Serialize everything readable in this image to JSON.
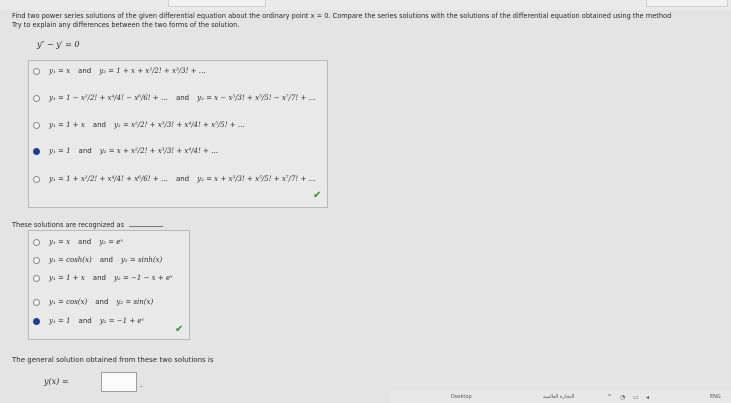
{
  "question": {
    "line1": "Find two power series solutions of the given differential equation about the ordinary point x = 0. Compare the series solutions with the solutions of the differential equation obtained using the method",
    "line2": "Try to explain any differences between the two forms of the solution.",
    "equation": "y″ − y′ = 0"
  },
  "part1": {
    "options": [
      {
        "y1": "y₁ = x",
        "connector": "and",
        "y2": "y₂ = 1 + x + x²/2! + x³/3! + …",
        "selected": false
      },
      {
        "y1": "y₁ = 1 − x²/2! + x⁴/4! − x⁶/6! + …",
        "connector": "and",
        "y2": "y₂ = x − x³/3! + x⁵/5! − x⁷/7! + …",
        "selected": false
      },
      {
        "y1": "y₁ = 1 + x",
        "connector": "and",
        "y2": "y₂ = x²/2! + x³/3! + x⁴/4! + x⁵/5! + …",
        "selected": false
      },
      {
        "y1": "y₁ = 1",
        "connector": "and",
        "y2": "y₂ = x + x²/2! + x³/3! + x⁴/4! + …",
        "selected": true
      },
      {
        "y1": "y₁ = 1 + x²/2! + x⁴/4! + x⁶/6! + …",
        "connector": "and",
        "y2": "y₂ = x + x³/3! + x⁵/5! + x⁷/7! + …",
        "selected": false
      }
    ],
    "check_mark": "✔"
  },
  "part2": {
    "prompt": "These solutions are recognized as",
    "options": [
      {
        "y1": "y₁ = x",
        "connector": "and",
        "y2": "y₂ = eˣ",
        "selected": false
      },
      {
        "y1": "y₁ = cosh(x)",
        "connector": "and",
        "y2": "y₂ = sinh(x)",
        "selected": false
      },
      {
        "y1": "y₁ = 1 + x",
        "connector": "and",
        "y2": "y₂ = −1 − x + eˣ",
        "selected": false
      },
      {
        "y1": "y₁ = cos(x)",
        "connector": "and",
        "y2": "y₂ = sin(x)",
        "selected": false
      },
      {
        "y1": "y₁ = 1",
        "connector": "and",
        "y2": "y₂ = −1 + eˣ",
        "selected": true
      }
    ],
    "check_mark": "✔"
  },
  "part3": {
    "prompt": "The general solution obtained from these two solutions is",
    "lhs": "y(x) =",
    "answer_value": "",
    "period": "."
  },
  "taskbar": {
    "desktop_label": "Desktop",
    "search_text": "التجارة العالمية",
    "lang": "ENG"
  }
}
